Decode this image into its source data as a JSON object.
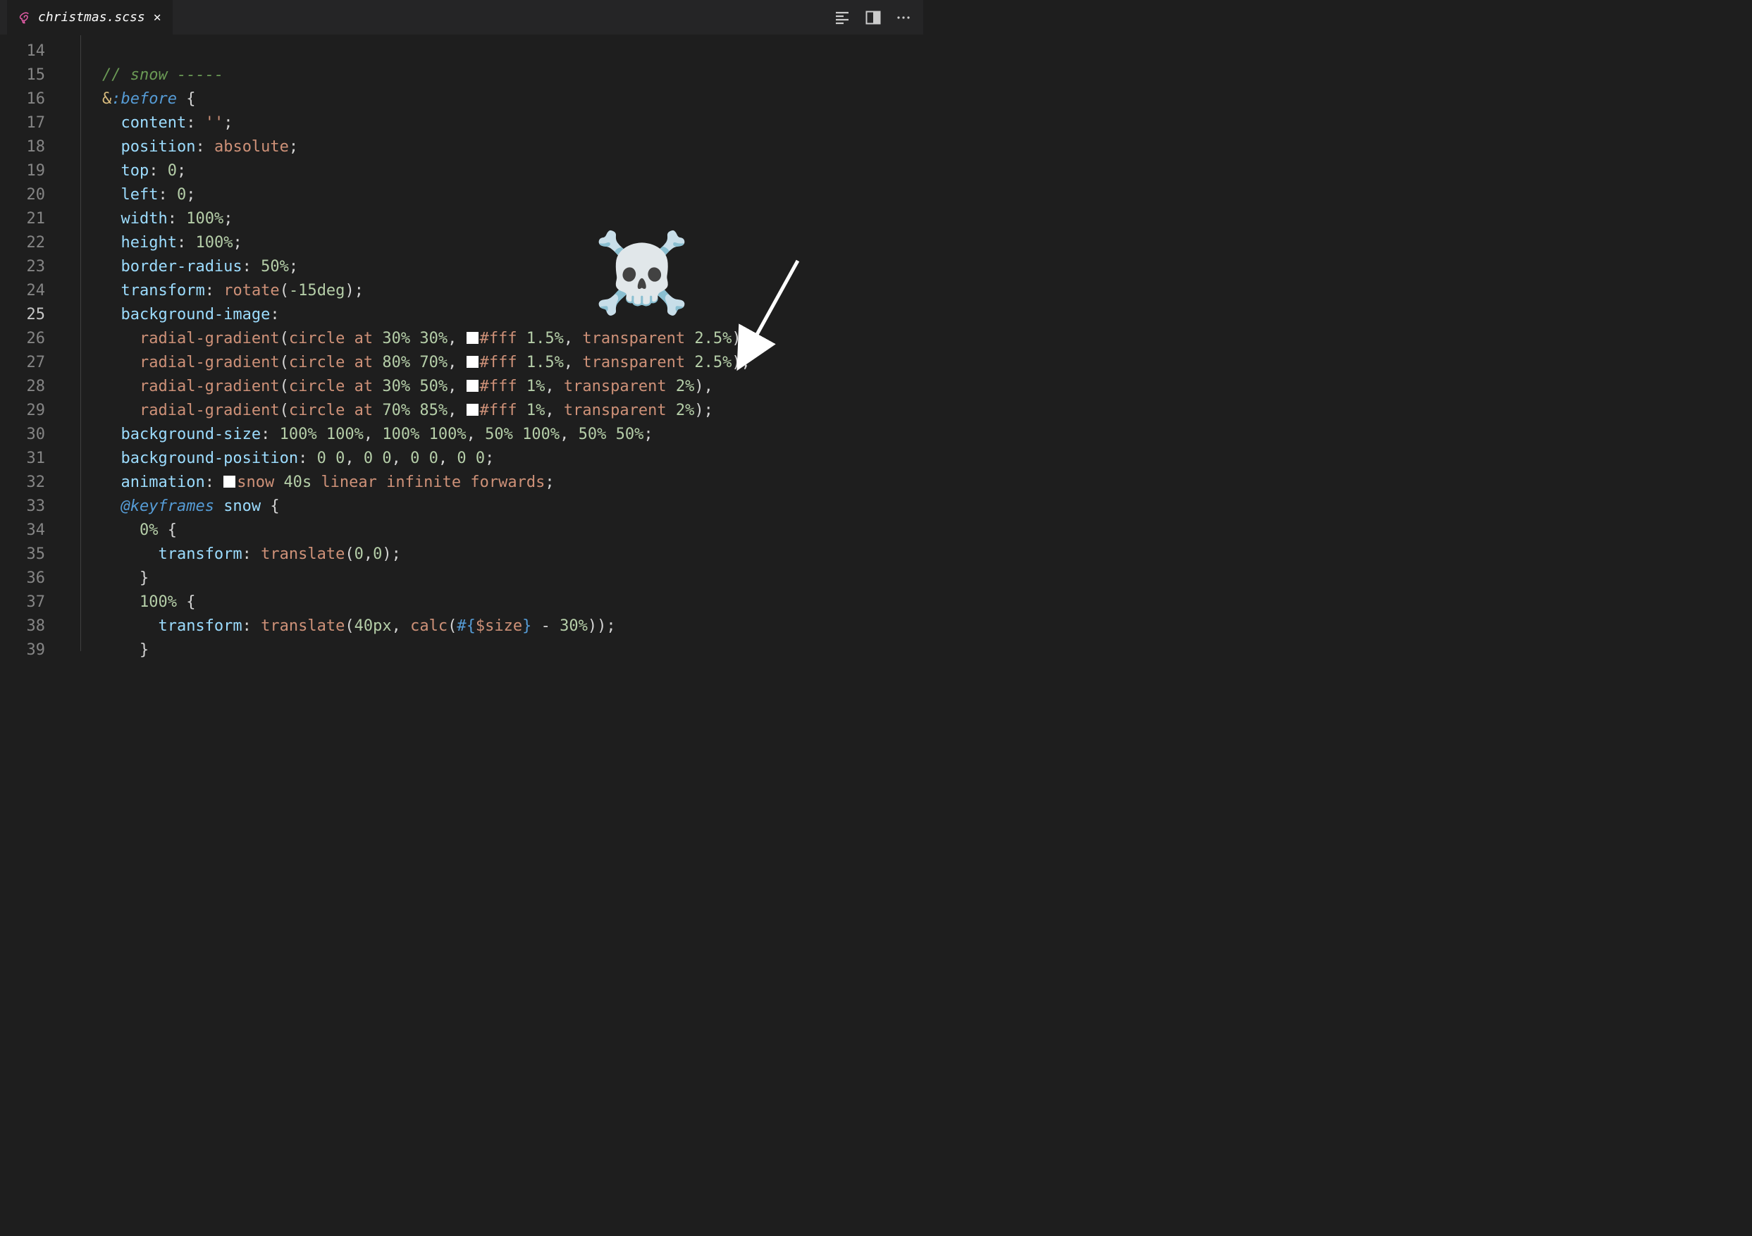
{
  "tab": {
    "filename": "christmas.scss",
    "file_type_icon": "sass-icon"
  },
  "line_numbers": {
    "start": 14,
    "end": 39,
    "active": 25
  },
  "annotations": {
    "skull_emoji": "☠️"
  },
  "code": {
    "l14": "",
    "l15": {
      "indent": "    ",
      "comment": "// snow -----"
    },
    "l16": {
      "indent": "    ",
      "selector_amp": "&",
      "selector_pseudo": ":before",
      "sp": " ",
      "brace": "{"
    },
    "l17": {
      "indent": "      ",
      "prop": "content",
      "val_string": "''"
    },
    "l18": {
      "indent": "      ",
      "prop": "position",
      "val": "absolute"
    },
    "l19": {
      "indent": "      ",
      "prop": "top",
      "val_num": "0"
    },
    "l20": {
      "indent": "      ",
      "prop": "left",
      "val_num": "0"
    },
    "l21": {
      "indent": "      ",
      "prop": "width",
      "val_num": "100",
      "val_unit": "%"
    },
    "l22": {
      "indent": "      ",
      "prop": "height",
      "val_num": "100",
      "val_unit": "%"
    },
    "l23": {
      "indent": "      ",
      "prop": "border-radius",
      "val_num": "50",
      "val_unit": "%"
    },
    "l24": {
      "indent": "      ",
      "prop": "transform",
      "func": "rotate",
      "arg_num": "-15",
      "arg_unit": "deg"
    },
    "l25": {
      "indent": "      ",
      "prop": "background-image"
    },
    "l26": {
      "indent": "        ",
      "func": "radial-gradient",
      "kw1": "circle",
      "kw2": "at",
      "p1": "30",
      "p2": "30",
      "c": "#fff",
      "s1": "1.5",
      "t": "transparent",
      "s2": "2.5",
      "end": ","
    },
    "l27": {
      "indent": "        ",
      "func": "radial-gradient",
      "kw1": "circle",
      "kw2": "at",
      "p1": "80",
      "p2": "70",
      "c": "#fff",
      "s1": "1.5",
      "t": "transparent",
      "s2": "2.5",
      "end": ","
    },
    "l28": {
      "indent": "        ",
      "func": "radial-gradient",
      "kw1": "circle",
      "kw2": "at",
      "p1": "30",
      "p2": "50",
      "c": "#fff",
      "s1": "1",
      "t": "transparent",
      "s2": "2",
      "end": ","
    },
    "l29": {
      "indent": "        ",
      "func": "radial-gradient",
      "kw1": "circle",
      "kw2": "at",
      "p1": "70",
      "p2": "85",
      "c": "#fff",
      "s1": "1",
      "t": "transparent",
      "s2": "2",
      "end": ";"
    },
    "l30": {
      "indent": "      ",
      "prop": "background-size",
      "raw_nums": [
        "100",
        "100",
        "100",
        "100",
        "50",
        "100",
        "50",
        "50"
      ],
      "pct": "%"
    },
    "l31": {
      "indent": "      ",
      "prop": "background-position",
      "raw_nums": [
        "0",
        "0",
        "0",
        "0",
        "0",
        "0",
        "0",
        "0"
      ]
    },
    "l32": {
      "indent": "      ",
      "prop": "animation",
      "name": "snow",
      "dur": "40",
      "dur_unit": "s",
      "timing": "linear",
      "iter": "infinite",
      "fill": "forwards"
    },
    "l33": {
      "indent": "      ",
      "at": "@keyframes",
      "name": "snow",
      "brace": "{"
    },
    "l34": {
      "indent": "        ",
      "pct": "0",
      "brace": "{"
    },
    "l35": {
      "indent": "          ",
      "prop": "transform",
      "func": "translate",
      "a1": "0",
      "a2": "0"
    },
    "l36": {
      "indent": "        ",
      "brace": "}"
    },
    "l37": {
      "indent": "        ",
      "pct": "100",
      "brace": "{"
    },
    "l38": {
      "indent": "          ",
      "prop": "transform",
      "func": "translate",
      "a1": "40",
      "a1u": "px",
      "calc": "calc",
      "interp_open": "#{",
      "var": "$size",
      "interp_close": "}",
      "op": " - ",
      "b": "30",
      "bu": "%"
    },
    "l39": {
      "indent": "        ",
      "brace": "}"
    }
  }
}
